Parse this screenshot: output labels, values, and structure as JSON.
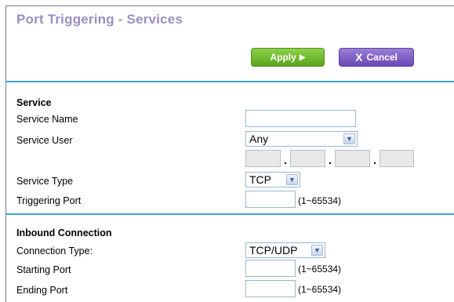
{
  "header": {
    "title": "Port Triggering - Services"
  },
  "toolbar": {
    "apply_label": "Apply",
    "apply_icon": "play-arrow-icon",
    "cancel_label": "Cancel",
    "cancel_icon": "x-icon"
  },
  "service": {
    "heading": "Service",
    "name_label": "Service Name",
    "name_value": "",
    "user_label": "Service User",
    "user_selected": "Any",
    "ip_octets": [
      "",
      "",
      "",
      ""
    ],
    "type_label": "Service Type",
    "type_selected": "TCP",
    "trigger_port_label": "Triggering Port",
    "trigger_port_value": "",
    "trigger_port_hint": "(1~65534)"
  },
  "inbound": {
    "heading": "Inbound Connection",
    "conn_type_label": "Connection Type:",
    "conn_type_selected": "TCP/UDP",
    "start_port_label": "Starting Port",
    "start_port_value": "",
    "start_port_hint": "(1~65534)",
    "end_port_label": "Ending Port",
    "end_port_value": "",
    "end_port_hint": "(1~65534)"
  },
  "colors": {
    "title": "#9a8fc1",
    "rule": "#3aa3d4",
    "apply": "#6cb52c",
    "cancel": "#7b5cc4"
  }
}
